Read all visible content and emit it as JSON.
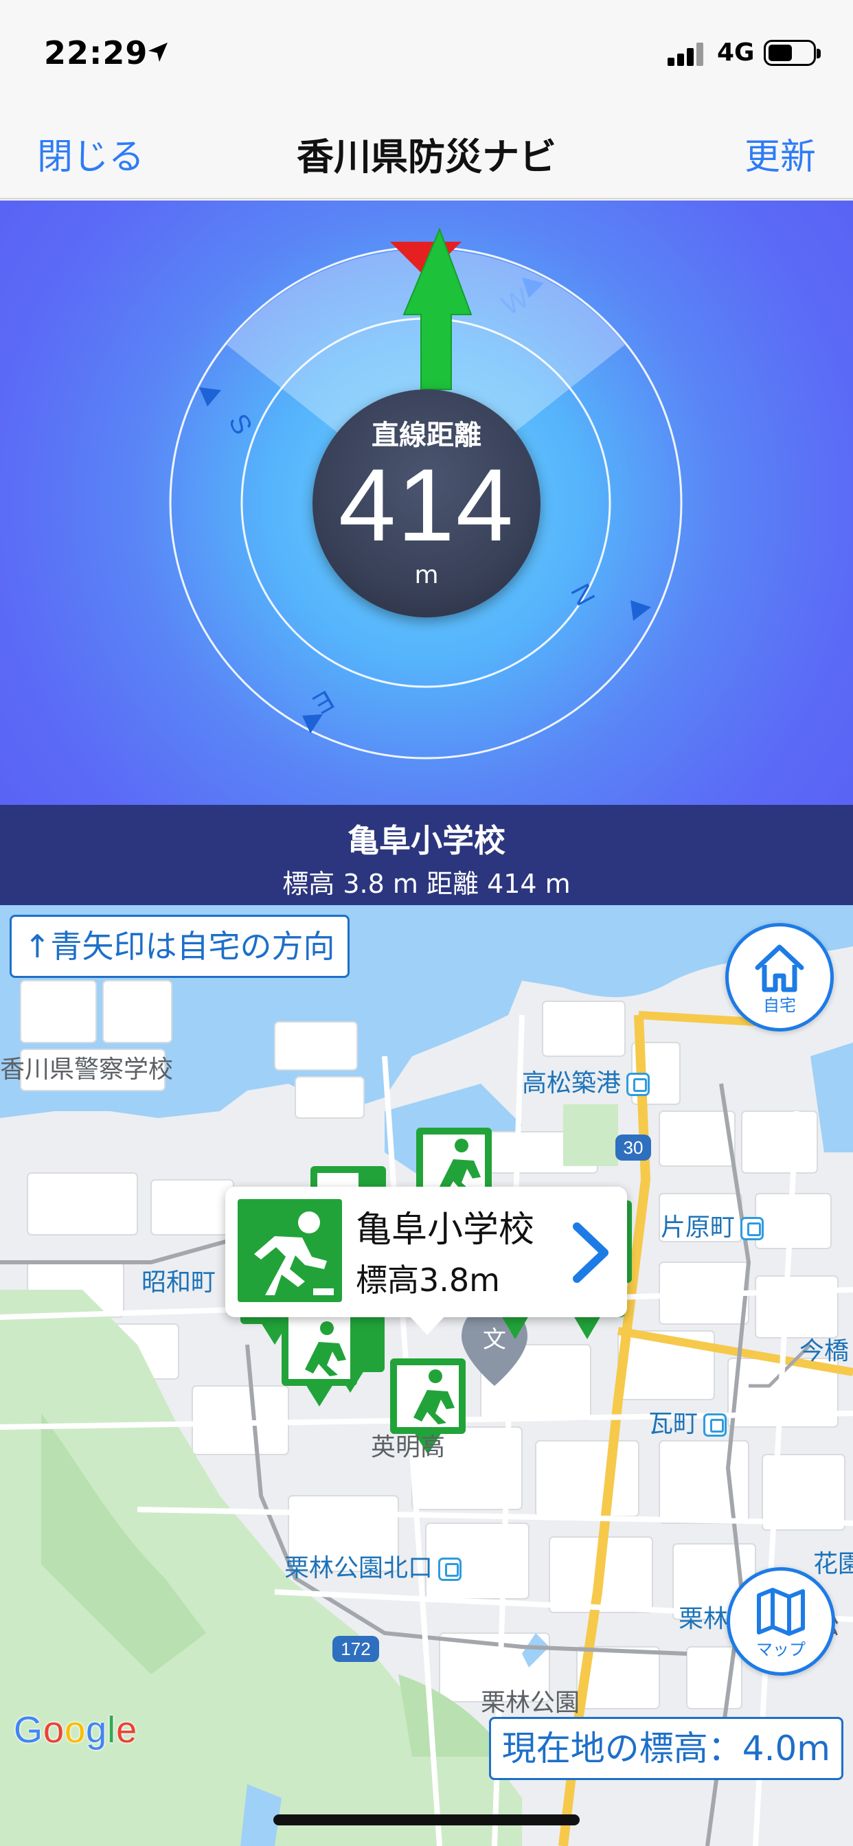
{
  "status_bar": {
    "time": "22:29",
    "network": "4G"
  },
  "nav": {
    "close_label": "閉じる",
    "title": "香川県防災ナビ",
    "refresh_label": "更新"
  },
  "compass": {
    "distance_label": "直線距離",
    "distance_value": "414",
    "distance_unit": "m",
    "directions": [
      "W",
      "S",
      "N",
      "E"
    ]
  },
  "destination": {
    "name": "亀阜小学校",
    "detail": "標高 3.8 m   距離 414 m"
  },
  "map": {
    "hint": "↑青矢印は自宅の方向",
    "home_button_label": "自宅",
    "map_button_label": "マップ",
    "current_elevation": "現在地の標高：4.0m",
    "labels": {
      "police_school": "香川県警察学校",
      "takamatsu_chikko": "高松築港",
      "route_30": "30",
      "katahara": "片原町",
      "showa": "昭和町",
      "imabashi": "今橋",
      "kawaramachi": "瓦町",
      "eimei": "英明高",
      "ritsurin_kita": "栗林公園北口",
      "ritsurin": "栗林",
      "takamatsu_high": "高松",
      "hanazono": "花園",
      "route_172": "172",
      "ritsurin_park": "栗林公園"
    },
    "callout": {
      "name": "亀阜小学校",
      "elevation": "標高3.8m"
    },
    "google_letters": [
      "G",
      "o",
      "o",
      "g",
      "l",
      "e"
    ]
  },
  "colors": {
    "accent": "#2e7cf6",
    "compass_blue": "#5a86f6",
    "info_bar": "#2c367e",
    "arrow_green": "#1ec13a",
    "north_red": "#e62020",
    "marker_green": "#21a339"
  }
}
